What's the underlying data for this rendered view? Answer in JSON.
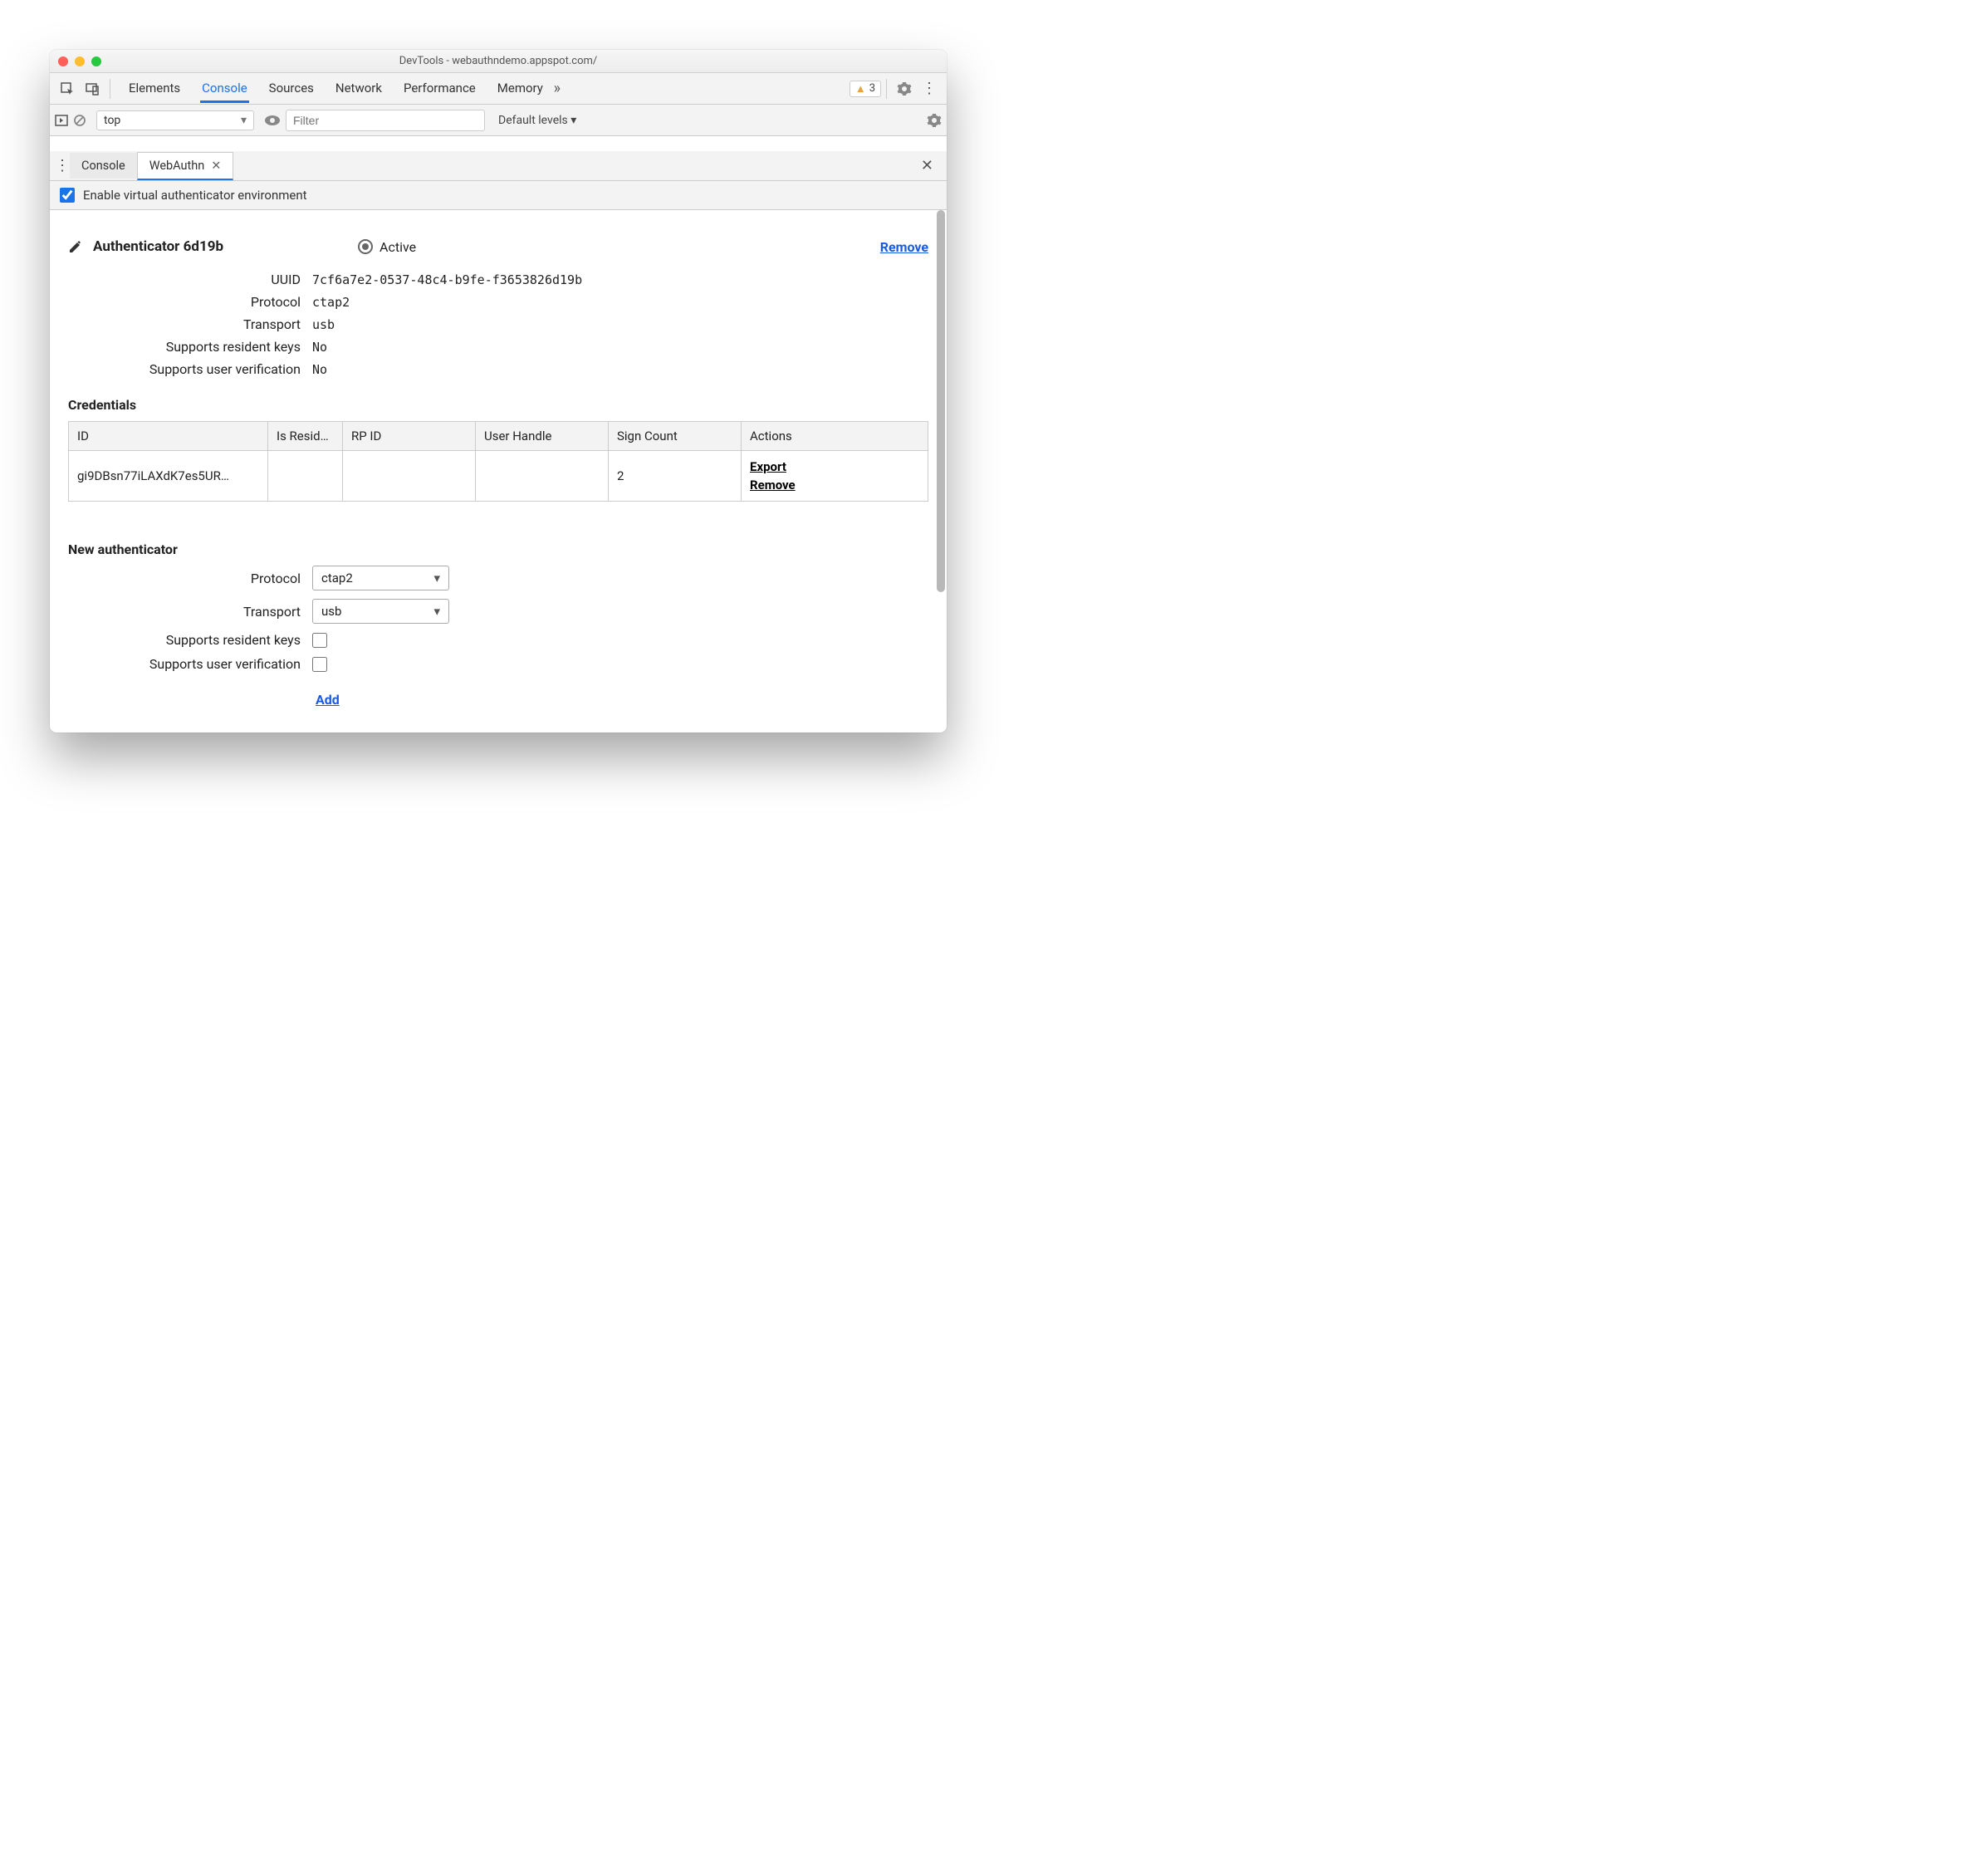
{
  "window_title": "DevTools - webauthndemo.appspot.com/",
  "main_tabs": [
    "Elements",
    "Console",
    "Sources",
    "Network",
    "Performance",
    "Memory"
  ],
  "main_tab_active": "Console",
  "warnings_count": "3",
  "console_bar": {
    "context": "top",
    "filter_placeholder": "Filter",
    "levels": "Default levels ▾"
  },
  "drawer": {
    "tabs": [
      "Console",
      "WebAuthn"
    ],
    "active": "WebAuthn"
  },
  "enable_label": "Enable virtual authenticator environment",
  "authenticator": {
    "title": "Authenticator 6d19b",
    "active_label": "Active",
    "remove_label": "Remove",
    "props": {
      "uuid_label": "UUID",
      "uuid": "7cf6a7e2-0537-48c4-b9fe-f3653826d19b",
      "protocol_label": "Protocol",
      "protocol": "ctap2",
      "transport_label": "Transport",
      "transport": "usb",
      "resident_label": "Supports resident keys",
      "resident": "No",
      "userverify_label": "Supports user verification",
      "userverify": "No"
    }
  },
  "credentials": {
    "title": "Credentials",
    "headers": {
      "id": "ID",
      "resident": "Is Resid…",
      "rp": "RP ID",
      "handle": "User Handle",
      "sign": "Sign Count",
      "actions": "Actions"
    },
    "row": {
      "id": "gi9DBsn77iLAXdK7es5UR…",
      "resident": "",
      "rp": "",
      "handle": "",
      "sign": "2",
      "export": "Export",
      "remove": "Remove"
    }
  },
  "new_auth": {
    "title": "New authenticator",
    "protocol_label": "Protocol",
    "protocol_value": "ctap2",
    "transport_label": "Transport",
    "transport_value": "usb",
    "resident_label": "Supports resident keys",
    "userverify_label": "Supports user verification",
    "add_label": "Add"
  }
}
